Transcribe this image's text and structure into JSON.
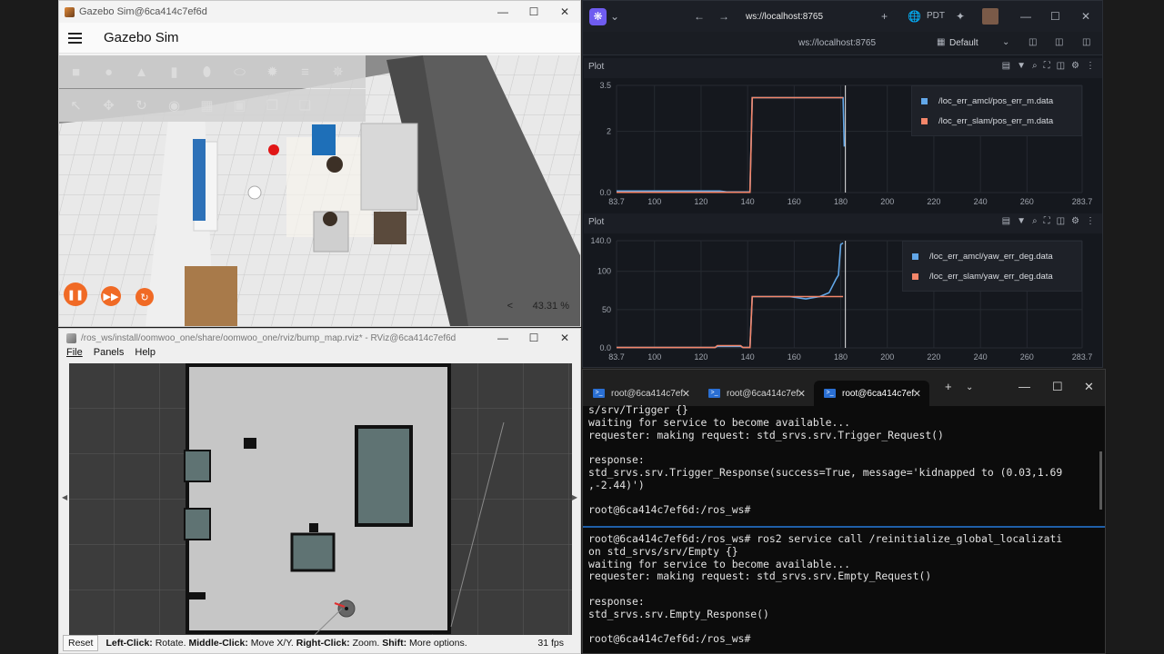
{
  "gazebo": {
    "window_title": "Gazebo Sim@6ca414c7ef6d",
    "app_title": "Gazebo Sim",
    "rtf_value": "43.31 %",
    "rtf_arrow": "<",
    "toolbar_row1": [
      "box-icon",
      "sphere-icon",
      "cone-icon",
      "cylinder-icon",
      "capsule-icon",
      "ellipsoid-icon",
      "sun-icon",
      "directional-light-icon",
      "spot-light-icon"
    ],
    "toolbar_row2": [
      "select-icon",
      "translate-icon",
      "rotate-icon",
      "transform-icon",
      "grid-snap-icon",
      "camera-icon",
      "copy-icon",
      "paste-icon"
    ]
  },
  "foxglove": {
    "tab_url": "ws://localhost:8765",
    "address": "ws://localhost:8765",
    "timezone": "PDT",
    "layout_name": "Default",
    "plots": [
      {
        "title": "Plot",
        "ylim": [
          0,
          3.5
        ],
        "xlim": [
          83.7,
          283.7
        ],
        "y_ticks": [
          "3.5",
          "2",
          "0.0"
        ],
        "y_tick_values": [
          3.5,
          2,
          0
        ],
        "x_ticks": [
          "83.7",
          "100",
          "120",
          "140",
          "160",
          "180",
          "200",
          "220",
          "240",
          "260",
          "283.7"
        ],
        "x_tick_values": [
          83.7,
          100,
          120,
          140,
          160,
          180,
          200,
          220,
          240,
          260,
          283.7
        ],
        "series": [
          {
            "name": "/loc_err_amcl/pos_err_m.data",
            "color": "#62a7e8",
            "x": [
              83.7,
              128,
              131,
              141,
              142,
              180,
              181,
              181.5
            ],
            "y": [
              0.05,
              0.05,
              0.02,
              0.02,
              3.1,
              3.1,
              3.1,
              1.5
            ]
          },
          {
            "name": "/loc_err_slam/pos_err_m.data",
            "color": "#f4866a",
            "x": [
              83.7,
              141,
              142,
              180,
              181
            ],
            "y": [
              0.01,
              0.01,
              3.1,
              3.1,
              3.1
            ]
          }
        ]
      },
      {
        "title": "Plot",
        "ylim": [
          0,
          140
        ],
        "xlim": [
          83.7,
          283.7
        ],
        "y_ticks": [
          "140.0",
          "100",
          "50",
          "0.0"
        ],
        "y_tick_values": [
          140,
          100,
          50,
          0
        ],
        "x_ticks": [
          "83.7",
          "100",
          "120",
          "140",
          "160",
          "180",
          "200",
          "220",
          "240",
          "260",
          "283.7"
        ],
        "x_tick_values": [
          83.7,
          100,
          120,
          140,
          160,
          180,
          200,
          220,
          240,
          260,
          283.7
        ],
        "series": [
          {
            "name": "/loc_err_amcl/yaw_err_deg.data",
            "color": "#62a7e8",
            "x": [
              83.7,
              126,
              127,
              137,
              138,
              141,
              142,
              158,
              165,
              171,
              175,
              178,
              179,
              180,
              181
            ],
            "y": [
              0.5,
              0.5,
              2,
              2,
              0.5,
              0.5,
              67,
              67,
              64,
              67,
              72,
              90,
              95,
              135,
              137
            ]
          },
          {
            "name": "/loc_err_slam/yaw_err_deg.data",
            "color": "#f4866a",
            "x": [
              83.7,
              126,
              127,
              137,
              138,
              141,
              142,
              181
            ],
            "y": [
              0.5,
              0.5,
              3,
              3,
              0.5,
              0.5,
              67,
              67
            ]
          }
        ]
      }
    ]
  },
  "rviz": {
    "window_title": "/ros_ws/install/oomwoo_one/share/oomwoo_one/rviz/bump_map.rviz* - RViz@6ca414c7ef6d",
    "menu": [
      "File",
      "Panels",
      "Help"
    ],
    "reset_label": "Reset",
    "status_segments": [
      {
        "b": "Left-Click:",
        "t": " Rotate. "
      },
      {
        "b": "Middle-Click:",
        "t": " Move X/Y. "
      },
      {
        "b": "Right-Click:",
        "t": " Zoom. "
      },
      {
        "b": "Shift:",
        "t": " More options."
      }
    ],
    "fps": "31 fps"
  },
  "terminal": {
    "tabs": [
      "root@6ca414c7ef",
      "root@6ca414c7ef",
      "root@6ca414c7ef"
    ],
    "pane1": "s/srv/Trigger {}\nwaiting for service to become available...\nrequester: making request: std_srvs.srv.Trigger_Request()\n\nresponse:\nstd_srvs.srv.Trigger_Response(success=True, message='kidnapped to (0.03,1.69\n,-2.44)')\n\nroot@6ca414c7ef6d:/ros_ws#",
    "pane2": "root@6ca414c7ef6d:/ros_ws# ros2 service call /reinitialize_global_localizati\non std_srvs/srv/Empty {}\nwaiting for service to become available...\nrequester: making request: std_srvs.srv.Empty_Request()\n\nresponse:\nstd_srvs.srv.Empty_Response()\n\nroot@6ca414c7ef6d:/ros_ws#"
  }
}
